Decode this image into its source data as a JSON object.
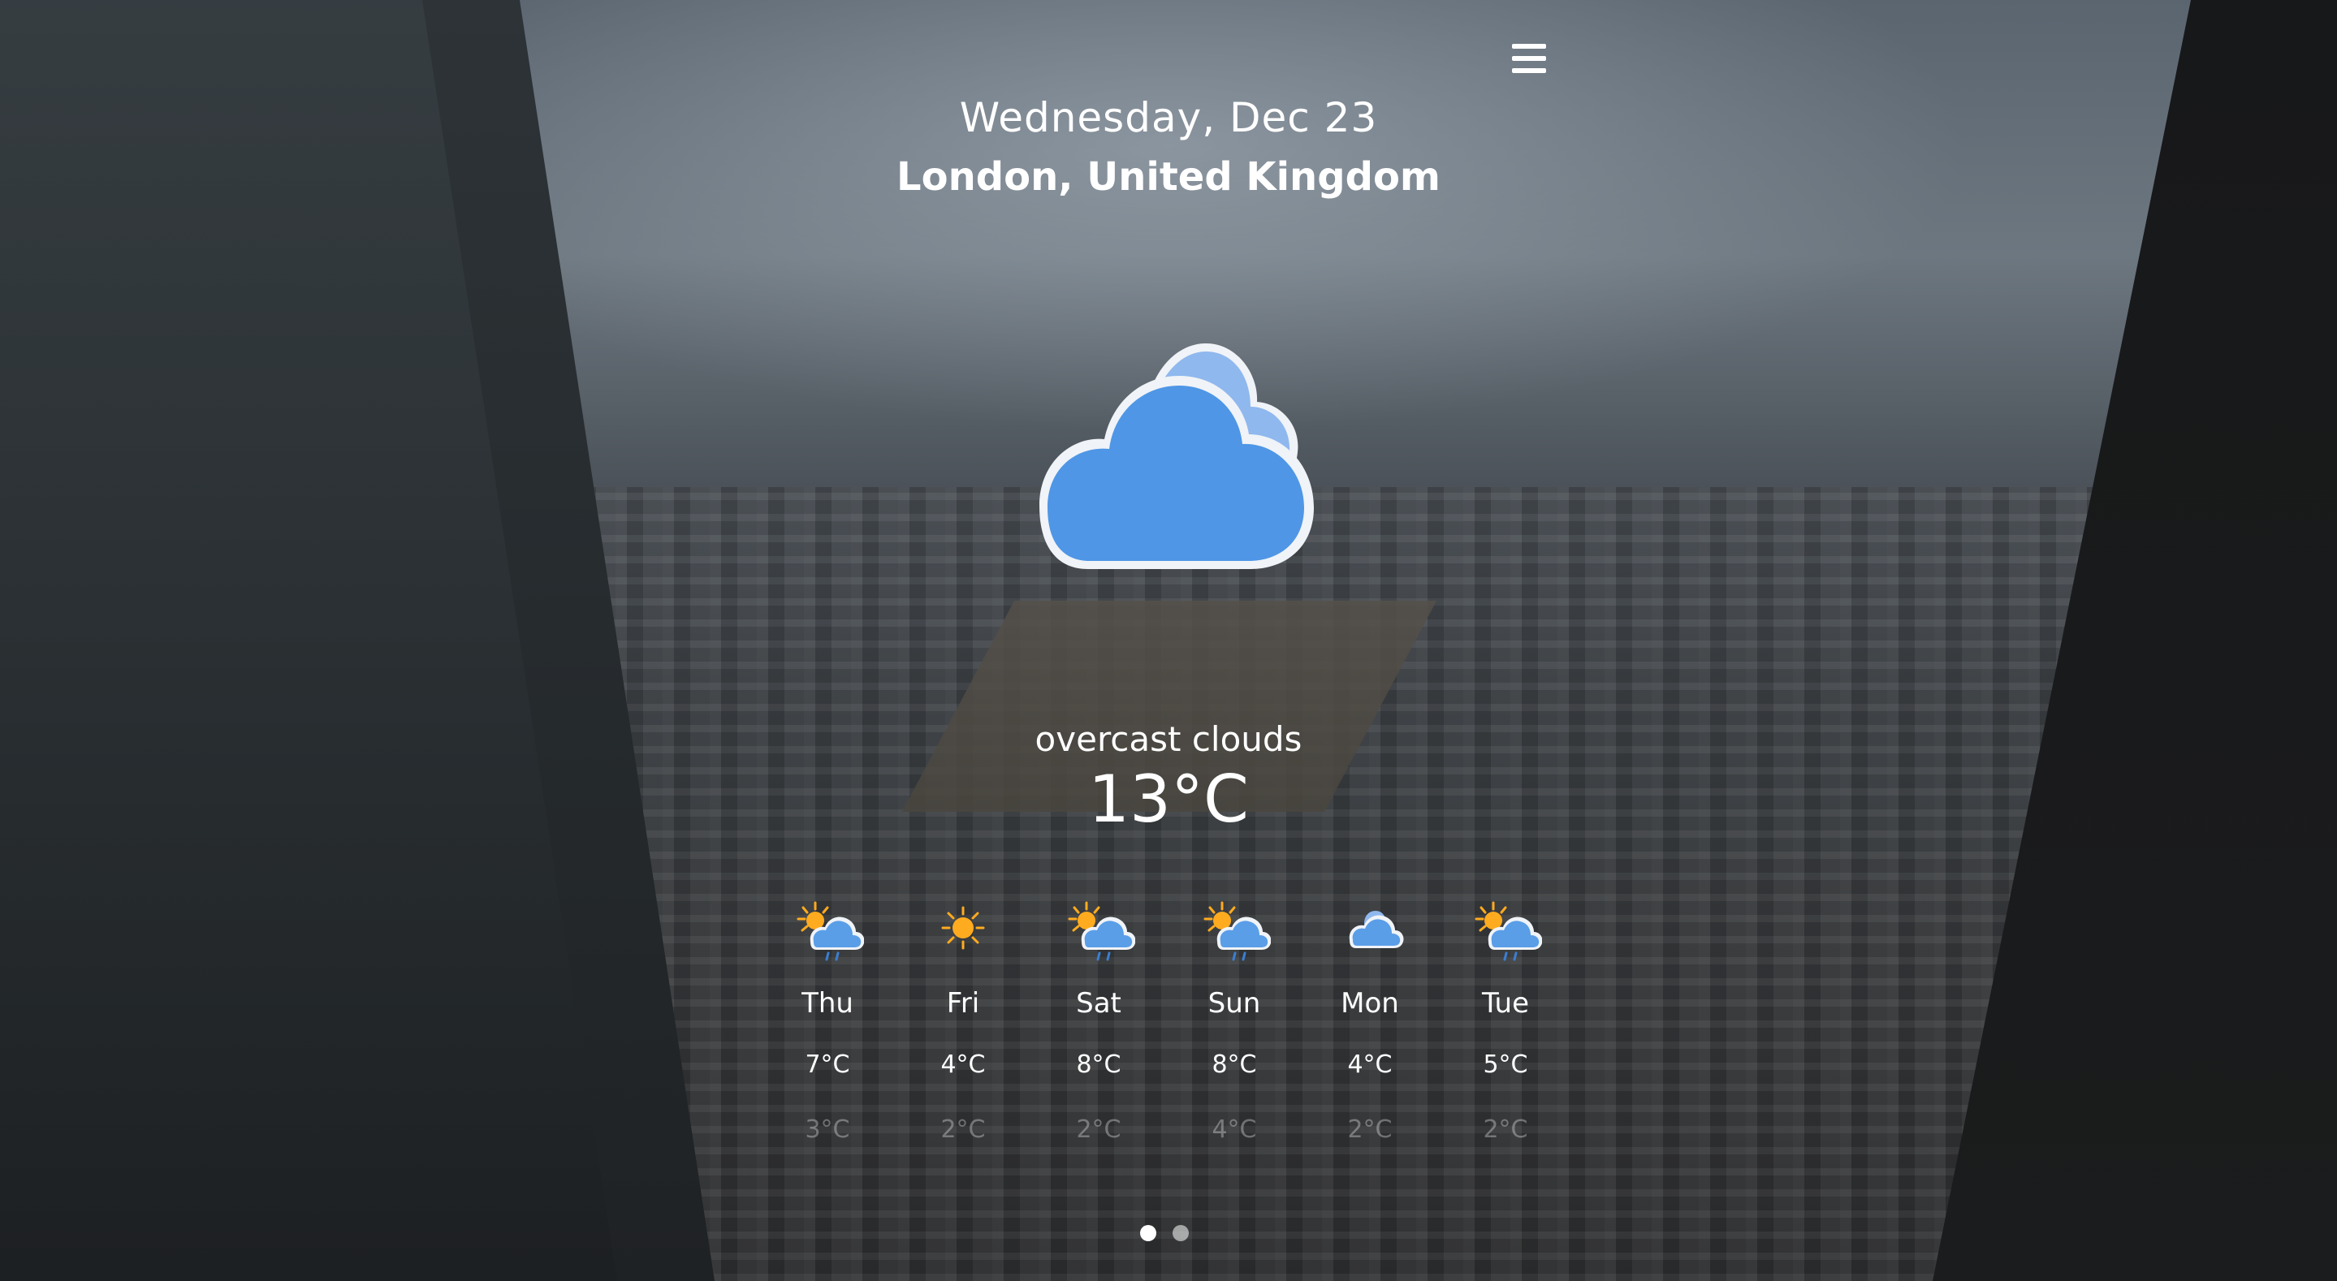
{
  "header": {
    "date": "Wednesday, Dec 23",
    "location": "London, United Kingdom"
  },
  "current": {
    "icon": "overcast-clouds-icon",
    "description": "overcast clouds",
    "temperature": "13°C"
  },
  "forecast": [
    {
      "day": "Thu",
      "icon": "sun-cloud-rain-icon",
      "max": "7°C",
      "min": "3°C"
    },
    {
      "day": "Fri",
      "icon": "sun-icon",
      "max": "4°C",
      "min": "2°C"
    },
    {
      "day": "Sat",
      "icon": "sun-cloud-rain-icon",
      "max": "8°C",
      "min": "2°C"
    },
    {
      "day": "Sun",
      "icon": "sun-cloud-rain-icon",
      "max": "8°C",
      "min": "4°C"
    },
    {
      "day": "Mon",
      "icon": "clouds-icon",
      "max": "4°C",
      "min": "2°C"
    },
    {
      "day": "Tue",
      "icon": "sun-cloud-rain-icon",
      "max": "5°C",
      "min": "2°C"
    }
  ],
  "pager": {
    "pages": 2,
    "active": 1
  },
  "colors": {
    "cloud": "#4f96e6",
    "cloud_back": "#8fb8ee",
    "sun": "#ffab1f",
    "rain": "#3b7fd1"
  }
}
